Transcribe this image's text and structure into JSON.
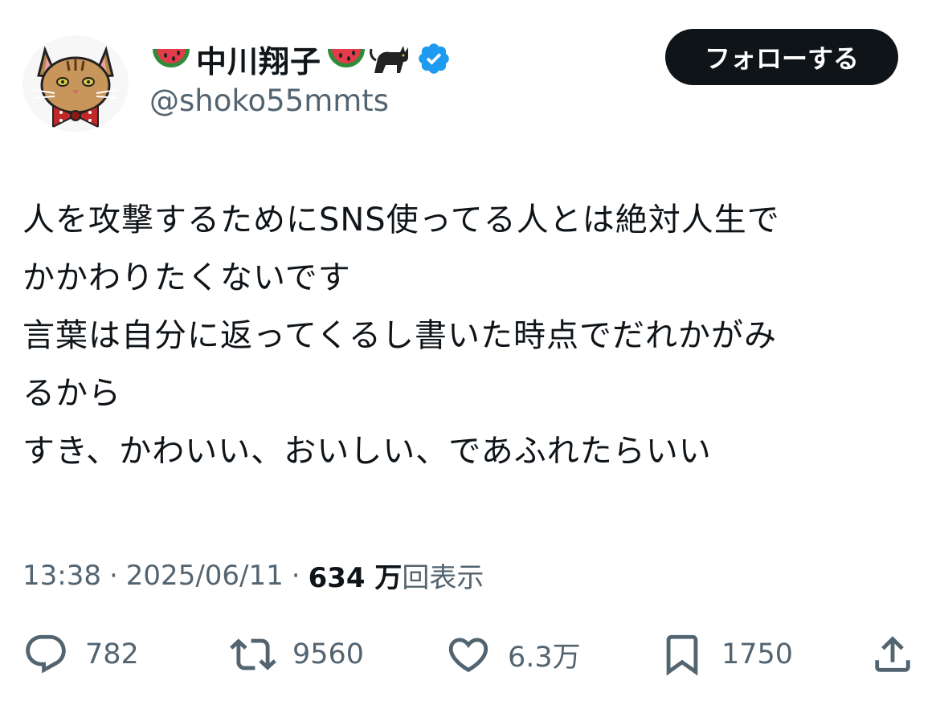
{
  "user": {
    "display_name": "中川翔子",
    "handle": "@shoko55mmts",
    "name_emojis": [
      "watermelon",
      "watermelon",
      "black-cat"
    ],
    "verified_badge_color": "#1d9bf0"
  },
  "follow_button": {
    "label": "フォローする"
  },
  "tweet": {
    "lines": [
      "人を攻撃するためにSNS使ってる人とは絶対人生で",
      "かかわりたくないです",
      "言葉は自分に返ってくるし書いた時点でだれかがみ",
      "るから",
      "すき、かわいい、おいしい、であふれたらいい"
    ],
    "time": "13:38",
    "date": "2025/06/11",
    "views_count": "634 万",
    "views_label": "回表示"
  },
  "actions": {
    "replies": "782",
    "retweets": "9560",
    "likes": "6.3万",
    "bookmarks": "1750"
  },
  "colors": {
    "text": "#0f1419",
    "secondary": "#536471",
    "follow_bg": "#0f1419",
    "verified": "#1d9bf0"
  }
}
